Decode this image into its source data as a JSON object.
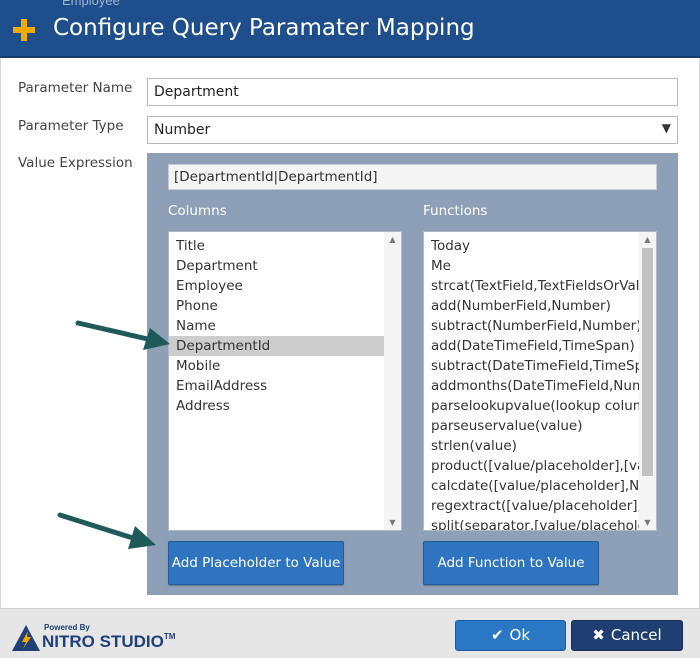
{
  "window": {
    "partial_header_text": "Employee",
    "title": "Configure Query Paramater Mapping"
  },
  "form": {
    "parameter_name_label": "Parameter Name",
    "parameter_name_value": "Department",
    "parameter_type_label": "Parameter Type",
    "parameter_type_value": "Number",
    "value_expression_label": "Value Expression"
  },
  "expression": {
    "value": "[DepartmentId|DepartmentId]"
  },
  "columns": {
    "label": "Columns",
    "items": [
      "Title",
      "Department",
      "Employee",
      "Phone",
      "Name",
      "DepartmentId",
      "Mobile",
      "EmailAddress",
      "Address"
    ],
    "selected": "DepartmentId",
    "add_button": "Add Placeholder to Value"
  },
  "functions": {
    "label": "Functions",
    "items": [
      "Today",
      "Me",
      "strcat(TextField,TextFieldsOrValues",
      "add(NumberField,Number)",
      "subtract(NumberField,Number)",
      "add(DateTimeField,TimeSpan)",
      "subtract(DateTimeField,TimeSpan)",
      "addmonths(DateTimeField,Numbe",
      "parselookupvalue(lookup column",
      "parseuservalue(value)",
      "strlen(value)",
      "product([value/placeholder],[value",
      "calcdate([value/placeholder],Numl",
      "regextract([value/placeholder],@e",
      "split(separator,[value/placeholder]"
    ],
    "add_button": "Add Function to Value"
  },
  "footer": {
    "logo_powered": "Powered By",
    "logo_brand": "NITRO STUDIO",
    "logo_tm": "TM",
    "ok_label": "Ok",
    "cancel_label": "Cancel"
  },
  "colors": {
    "title_bar": "#1f4e8c",
    "accent_plus": "#f2a900",
    "panel": "#8ea0b8",
    "button_blue": "#2e74c0",
    "cancel_navy": "#1f3f73",
    "annotation_arrow": "#1f5a5a"
  },
  "icons": {
    "add": "plus-icon",
    "ok": "check-icon",
    "cancel": "x-icon",
    "dropdown": "chevron-down-icon",
    "scroll_up": "arrow-up-icon",
    "scroll_down": "arrow-down-icon",
    "logo": "lightning-logo-icon"
  }
}
